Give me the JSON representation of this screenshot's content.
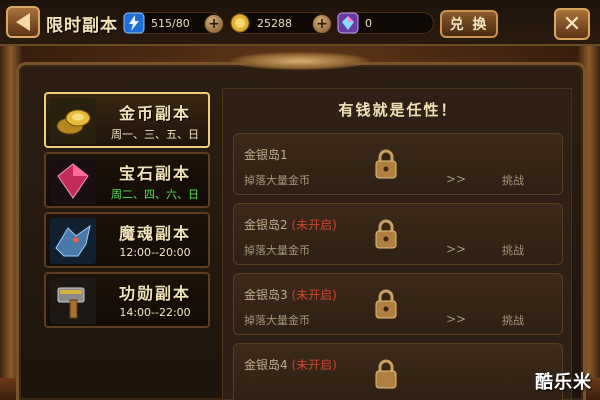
{
  "header": {
    "title": "限时副本",
    "energy": "515/80",
    "gold": "25288",
    "gems": "0",
    "exchange_label": "兑 换"
  },
  "tabs": [
    {
      "name": "金币副本",
      "time": "周一、三、五、日"
    },
    {
      "name": "宝石副本",
      "time": "周二、四、六、日"
    },
    {
      "name": "魔魂副本",
      "time": "12:00--20:00"
    },
    {
      "name": "功勋副本",
      "time": "14:00--22:00"
    }
  ],
  "panel": {
    "title": "有钱就是任性！",
    "stages": [
      {
        "name": "金银岛1",
        "status": "",
        "desc": "掉落大量金币",
        "action": "挑战"
      },
      {
        "name": "金银岛2",
        "status": "(未开启)",
        "desc": "掉落大量金币",
        "action": "挑战"
      },
      {
        "name": "金银岛3",
        "status": "(未开启)",
        "desc": "掉落大量金币",
        "action": "挑战"
      },
      {
        "name": "金银岛4",
        "status": "(未开启)",
        "desc": "",
        "action": ""
      }
    ]
  },
  "watermark": "酷乐米"
}
